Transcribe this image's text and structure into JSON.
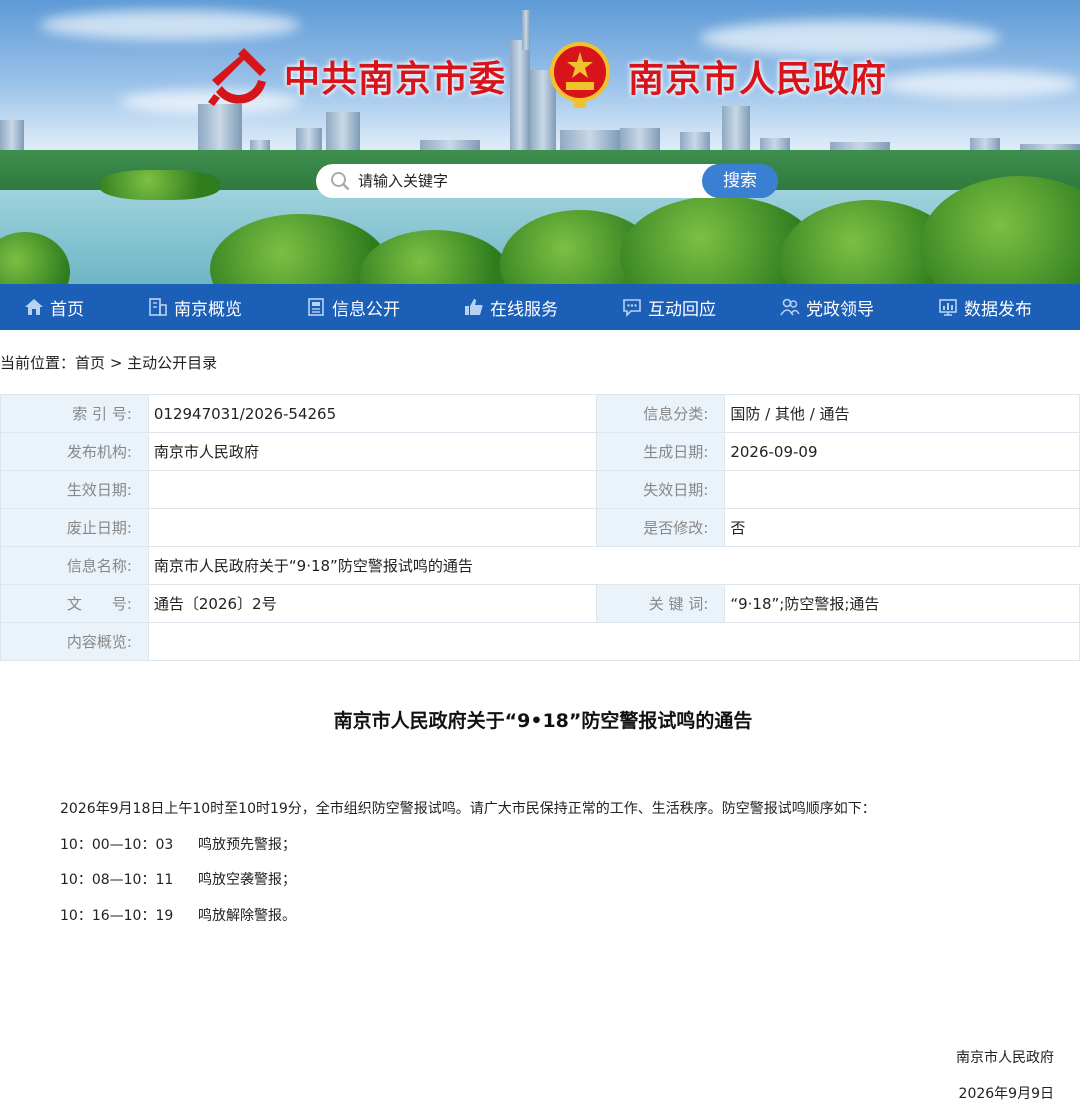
{
  "header": {
    "party_title": "中共南京市委",
    "gov_title": "南京市人民政府",
    "search_placeholder": "请输入关键字",
    "search_button": "搜索"
  },
  "nav": {
    "items": [
      {
        "label": "首页",
        "icon": "home-icon"
      },
      {
        "label": "南京概览",
        "icon": "building-icon"
      },
      {
        "label": "信息公开",
        "icon": "document-icon"
      },
      {
        "label": "在线服务",
        "icon": "thumbs-up-icon"
      },
      {
        "label": "互动回应",
        "icon": "chat-icon"
      },
      {
        "label": "党政领导",
        "icon": "people-icon"
      },
      {
        "label": "数据发布",
        "icon": "chart-icon"
      }
    ]
  },
  "breadcrumb": {
    "prefix": "当前位置：",
    "home": "首页",
    "sep": ">",
    "current": "主动公开目录"
  },
  "meta": {
    "index_label": "索 引 号:",
    "index_value": "012947031/2026-54265",
    "category_label": "信息分类:",
    "category_value": "国防 / 其他 / 通告",
    "publisher_label": "发布机构:",
    "publisher_value": "南京市人民政府",
    "created_label": "生成日期:",
    "created_value": "2026-09-09",
    "effective_label": "生效日期:",
    "effective_value": "",
    "expire_label": "失效日期:",
    "expire_value": "",
    "abolish_label": "废止日期:",
    "abolish_value": "",
    "modified_label": "是否修改:",
    "modified_value": "否",
    "name_label": "信息名称:",
    "name_value": "南京市人民政府关于“9·18”防空警报试鸣的通告",
    "docno_label": "文　　号:",
    "docno_value": "通告〔2026〕2号",
    "keywords_label": "关 键 词:",
    "keywords_value": "“9·18”;防空警报;通告",
    "summary_label": "内容概览:",
    "summary_value": ""
  },
  "article": {
    "title": "南京市人民政府关于“9•18”防空警报试鸣的通告",
    "intro": "2026年9月18日上午10时至10时19分，全市组织防空警报试鸣。请广大市民保持正常的工作、生活秩序。防空警报试鸣顺序如下：",
    "schedule": [
      {
        "time": "10：00—10：03",
        "text": "鸣放预先警报；"
      },
      {
        "time": "10：08—10：11",
        "text": "鸣放空袭警报；"
      },
      {
        "time": "10：16—10：19",
        "text": "鸣放解除警报。"
      }
    ],
    "signer": "南京市人民政府",
    "date": "2026年9月9日"
  }
}
